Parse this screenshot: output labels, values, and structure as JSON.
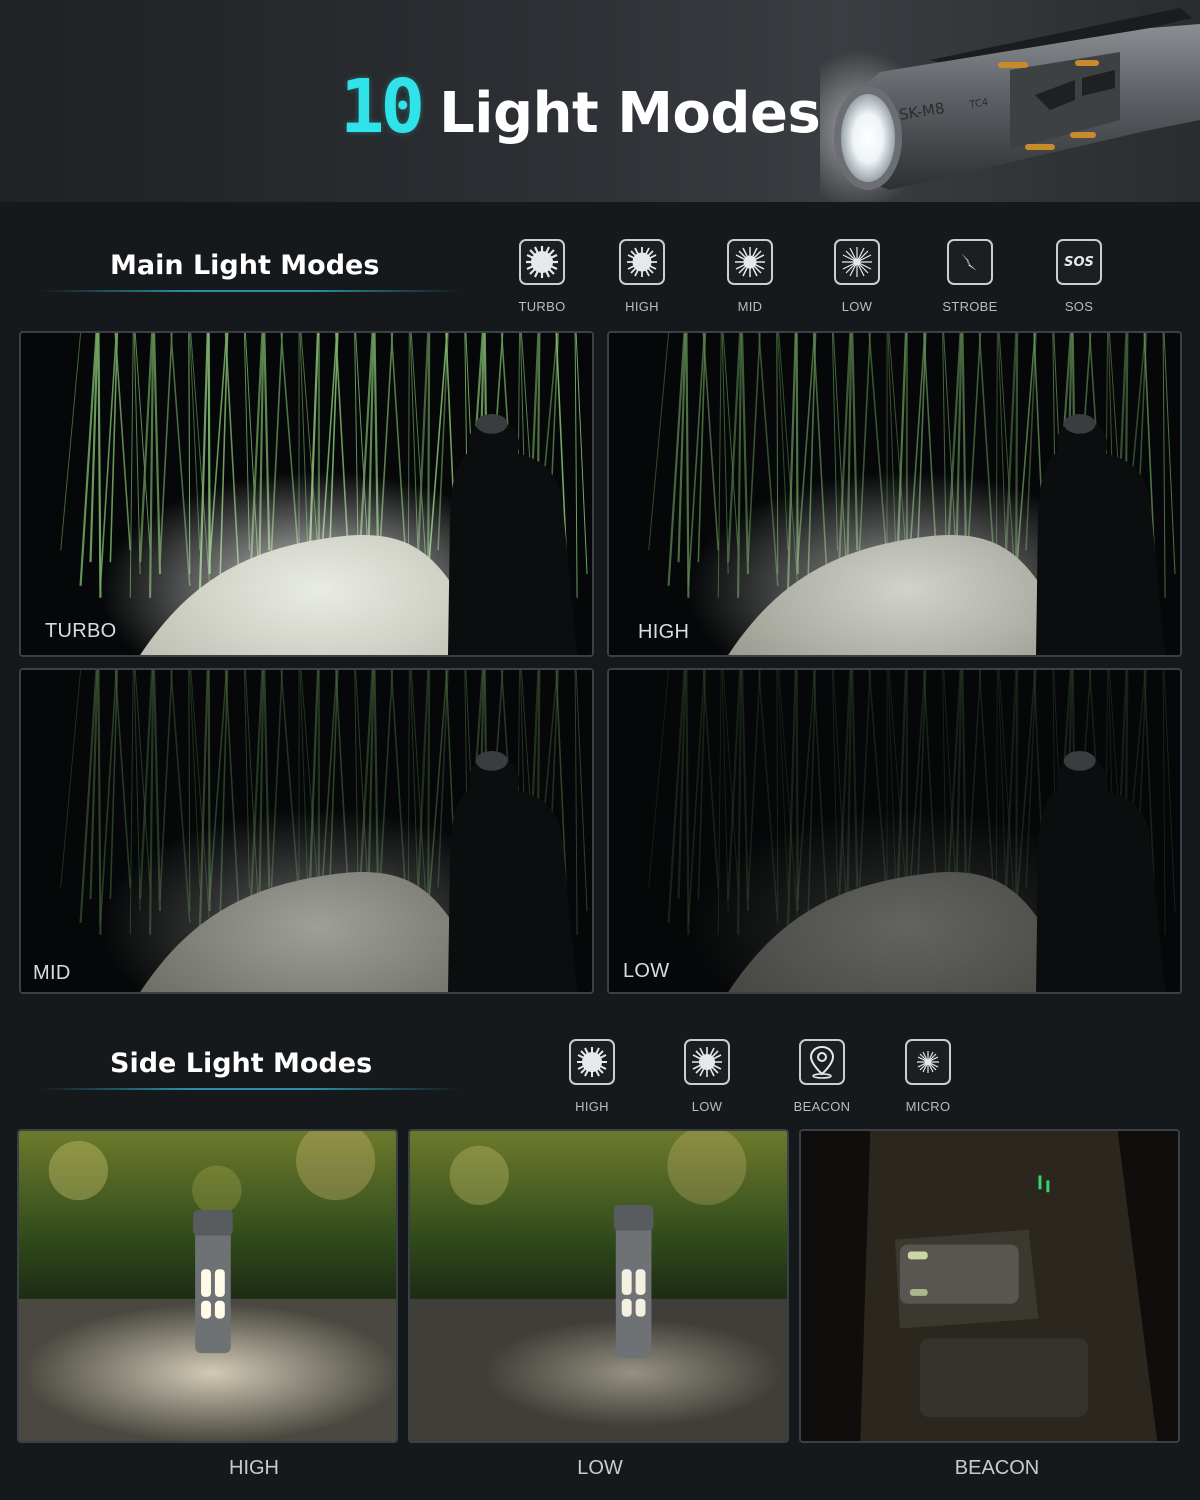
{
  "header": {
    "title_number": "10",
    "title_text": "Light Modes",
    "torch_model": "SK-M8",
    "torch_badge": "TC4"
  },
  "main_section": {
    "heading": "Main Light Modes",
    "icons": [
      {
        "label": "TURBO",
        "icon": "turbo-burst-icon"
      },
      {
        "label": "HIGH",
        "icon": "high-burst-icon"
      },
      {
        "label": "MID",
        "icon": "mid-burst-icon"
      },
      {
        "label": "LOW",
        "icon": "low-burst-icon"
      },
      {
        "label": "STROBE",
        "icon": "lightning-bolt-icon"
      },
      {
        "label": "SOS",
        "icon": "sos-icon",
        "glyph": "SOS"
      }
    ],
    "panels": [
      {
        "label": "TURBO",
        "brightness": 1.0
      },
      {
        "label": "HIGH",
        "brightness": 0.75
      },
      {
        "label": "MID",
        "brightness": 0.45
      },
      {
        "label": "LOW",
        "brightness": 0.2
      }
    ]
  },
  "side_section": {
    "heading": "Side Light Modes",
    "icons": [
      {
        "label": "HIGH",
        "icon": "high-burst-icon"
      },
      {
        "label": "LOW",
        "icon": "low-burst-icon"
      },
      {
        "label": "BEACON",
        "icon": "location-pin-icon"
      },
      {
        "label": "MICRO",
        "icon": "micro-burst-icon"
      }
    ],
    "captions": [
      "HIGH",
      "LOW",
      "BEACON"
    ]
  },
  "colors": {
    "accent_cyan": "#2fe3e8",
    "background": "#16191c",
    "section_line": "#2a8fa6"
  }
}
